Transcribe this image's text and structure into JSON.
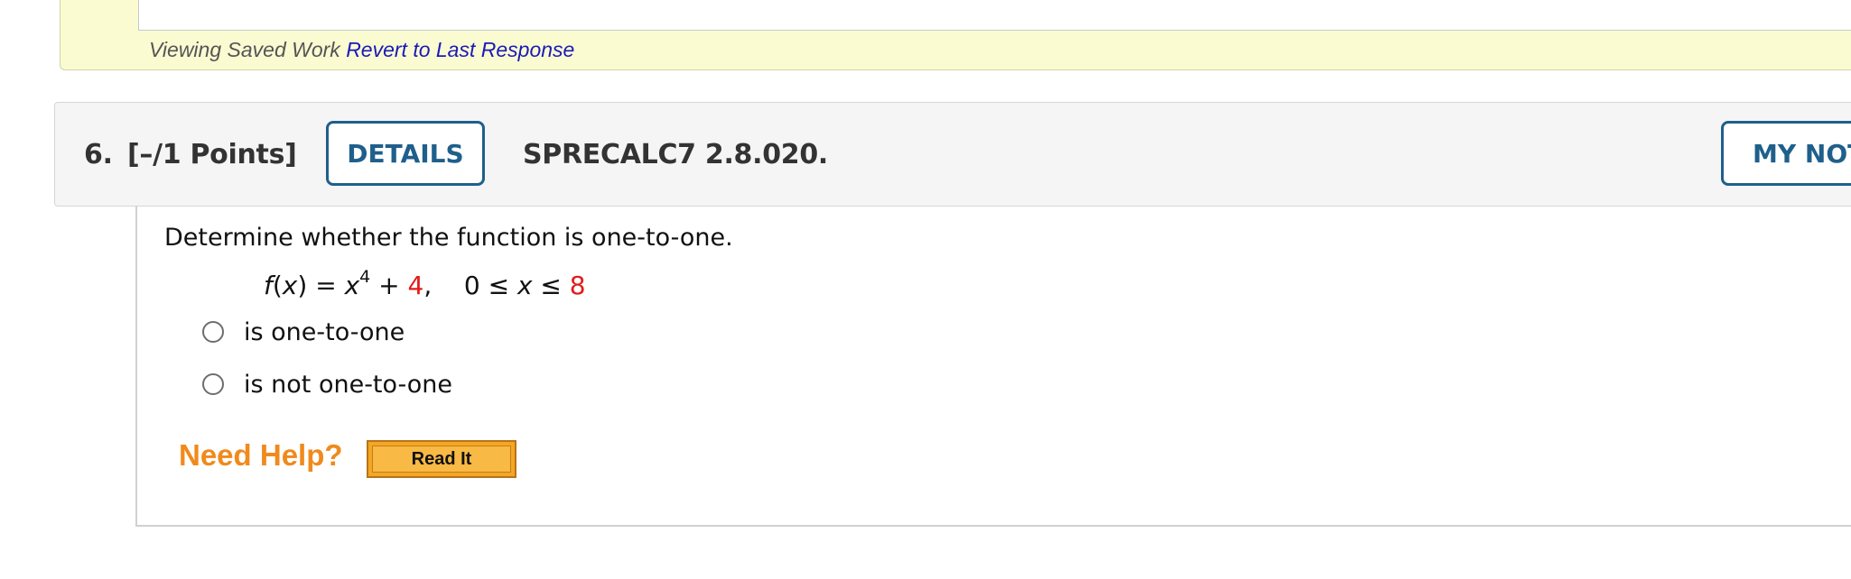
{
  "previous": {
    "saved_text": "Viewing Saved Work",
    "revert_link": "Revert to Last Response"
  },
  "question": {
    "number": "6.",
    "points": "[–/1 Points]",
    "details_label": "DETAILS",
    "code": "SPRECALC7 2.8.020.",
    "notes_label": "MY NOTES",
    "prompt": "Determine whether the function is one-to-one.",
    "formula": {
      "f": "f",
      "x1": "x",
      "x2": "x",
      "exponent": "4",
      "constant": "4",
      "lower": "0",
      "upper": "8"
    },
    "choices": [
      {
        "label": "is one-to-one",
        "selected": false
      },
      {
        "label": "is not one-to-one",
        "selected": false
      }
    ],
    "need_help": "Need Help?",
    "read_it": "Read It"
  },
  "colors": {
    "accent_blue": "#1f5f8b",
    "highlight_red": "#e21b1b",
    "help_orange": "#f08a1c",
    "saved_bg": "#fbfbd2"
  }
}
